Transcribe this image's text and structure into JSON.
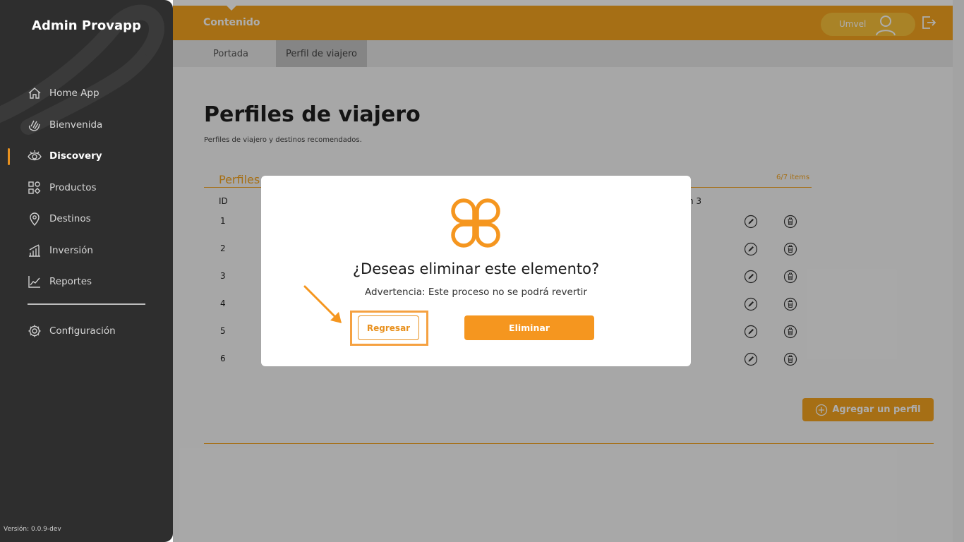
{
  "sidebar": {
    "brand": "Admin Provapp",
    "items": [
      {
        "label": "Home App",
        "icon": "home-icon"
      },
      {
        "label": "Bienvenida",
        "icon": "waving-hand-icon"
      },
      {
        "label": "Discovery",
        "icon": "eye-icon",
        "active": true
      },
      {
        "label": "Productos",
        "icon": "grid-shapes-icon"
      },
      {
        "label": "Destinos",
        "icon": "location-pin-icon"
      },
      {
        "label": "Inversión",
        "icon": "bar-chart-icon"
      },
      {
        "label": "Reportes",
        "icon": "line-chart-icon"
      }
    ],
    "config": {
      "label": "Configuración",
      "icon": "gear-icon"
    },
    "version": "Versión: 0.0.9-dev"
  },
  "topbar": {
    "title": "Contenido",
    "user_name": "Umvel"
  },
  "subtabs": [
    {
      "label": "Portada"
    },
    {
      "label": "Perfil de viajero",
      "active": true
    }
  ],
  "page": {
    "title": "Perfiles de viajero",
    "subtitle": "Perfiles de viajero y destinos recomendados.",
    "section_title": "Perfiles",
    "items_count": "6/7 items",
    "columns": {
      "id": "ID",
      "col3": "n 3"
    },
    "rows": [
      "1",
      "2",
      "3",
      "4",
      "5",
      "6"
    ],
    "add_button": "Agregar un perfil"
  },
  "modal": {
    "question": "¿Deseas eliminar este elemento?",
    "warning": "Advertencia: Este proceso no se podrá revertir",
    "back_button": "Regresar",
    "delete_button": "Eliminar"
  },
  "colors": {
    "accent": "#f5a41f",
    "sidebar_bg": "#2e2e2e",
    "highlight": "#f5a141"
  }
}
